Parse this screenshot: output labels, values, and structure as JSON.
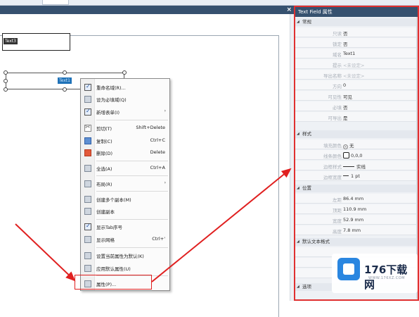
{
  "document": {
    "close_glyph": "×",
    "fields": [
      {
        "label": "Text3"
      },
      {
        "label": "Text1"
      }
    ]
  },
  "context_menu": {
    "items": [
      {
        "label": "重命名域(R)...",
        "shortcut": "",
        "submenu": false
      },
      {
        "label": "设为必填域(Q)",
        "shortcut": "",
        "submenu": false
      },
      {
        "label": "新增表单(I)",
        "shortcut": "",
        "submenu": true
      },
      {
        "label": "剪切(T)",
        "shortcut": "Shift+Delete",
        "submenu": false
      },
      {
        "label": "复制(C)",
        "shortcut": "Ctrl+C",
        "submenu": false
      },
      {
        "label": "删除(D)",
        "shortcut": "Delete",
        "submenu": false
      },
      {
        "label": "全选(A)",
        "shortcut": "Ctrl+A",
        "submenu": false
      },
      {
        "label": "布局(R)",
        "shortcut": "",
        "submenu": true
      },
      {
        "label": "创建多个副本(M)",
        "shortcut": "",
        "submenu": false
      },
      {
        "label": "创建副本",
        "shortcut": "",
        "submenu": false
      },
      {
        "label": "显示Tab序号",
        "shortcut": "",
        "submenu": false
      },
      {
        "label": "显示网格",
        "shortcut": "Ctrl+'",
        "submenu": false
      },
      {
        "label": "设置当前属性为默认(K)",
        "shortcut": "",
        "submenu": false
      },
      {
        "label": "应用默认属性(U)",
        "shortcut": "",
        "submenu": false
      },
      {
        "label": "属性(P)...",
        "shortcut": "",
        "submenu": false
      }
    ],
    "submenu_glyph": "›"
  },
  "properties_panel": {
    "title": "Text Field 属性",
    "sections": {
      "general": "常规",
      "style": "样式",
      "position": "位置",
      "default_text": "默认文本格式",
      "options": "选项"
    },
    "general_rows": [
      {
        "key": "只读",
        "value": "否"
      },
      {
        "key": "锁定",
        "value": "否"
      },
      {
        "key": "域名",
        "value": "Text1"
      },
      {
        "key": "提示",
        "value": "<未设定>"
      },
      {
        "key": "导出名称",
        "value": "<未设定>"
      },
      {
        "key": "方向",
        "value": "0"
      },
      {
        "key": "可见性",
        "value": "可见"
      },
      {
        "key": "必填",
        "value": "否"
      },
      {
        "key": "可导出",
        "value": "是"
      }
    ],
    "style_rows": [
      {
        "key": "填充颜色",
        "value": "无"
      },
      {
        "key": "线条颜色",
        "value": "0,0,0"
      },
      {
        "key": "边框样式",
        "value": "实线"
      },
      {
        "key": "边框宽度",
        "value": "1 pt"
      }
    ],
    "position_rows": [
      {
        "key": "左距",
        "value": "86.4 mm"
      },
      {
        "key": "顶距",
        "value": "110.9 mm"
      },
      {
        "key": "宽度",
        "value": "52.9 mm"
      },
      {
        "key": "高度",
        "value": "7.8 mm"
      }
    ]
  },
  "watermark": {
    "brand": "176下载网",
    "url": "WWW.176XZ.COM"
  },
  "colors": {
    "accent_red": "#e02020",
    "header_blue": "#36516f",
    "selection_blue": "#1f72b8"
  }
}
